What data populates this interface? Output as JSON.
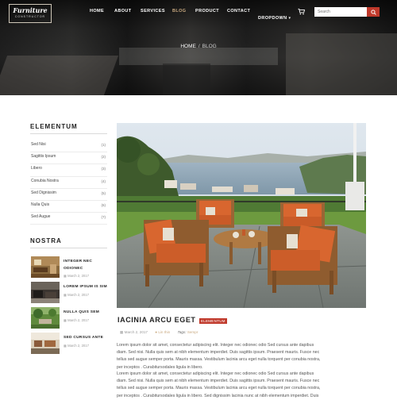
{
  "header": {
    "logo_title": "Furniture",
    "logo_subtitle": "CONSTRUCTOR",
    "nav": [
      {
        "label": "HOME",
        "active": false
      },
      {
        "label": "ABOUT",
        "active": false
      },
      {
        "label": "SERVICES",
        "active": false
      },
      {
        "label": "BLOG",
        "active": true
      },
      {
        "label": "PRODUCT",
        "active": false
      },
      {
        "label": "CONTACT",
        "active": false
      },
      {
        "label": "DROPDOWN",
        "active": false,
        "has_caret": true
      }
    ],
    "cart_icon": "cart-icon",
    "search_placeholder": "Search",
    "search_icon": "search-icon",
    "accent_color": "#c0392b"
  },
  "breadcrumb": {
    "home": "HOME",
    "separator": "/",
    "current": "BLOG"
  },
  "sidebar": {
    "categories_title": "ELEMENTUM",
    "categories": [
      {
        "label": "Sed Nisi",
        "count": "(1)"
      },
      {
        "label": "Sagittis Ipsum",
        "count": "(2)"
      },
      {
        "label": "Libero",
        "count": "(3)"
      },
      {
        "label": "Conubia Nostra",
        "count": "(4)"
      },
      {
        "label": "Sed Dignissim",
        "count": "(5)"
      },
      {
        "label": "Nulla Quis",
        "count": "(6)"
      },
      {
        "label": "Sed Augue",
        "count": "(7)"
      }
    ],
    "recent_title": "NOSTRA",
    "recent_posts": [
      {
        "title": "INTEGER NEC ODIONEC",
        "date": "March 2, 2017"
      },
      {
        "title": "LOREM IPSUM IS SIM",
        "date": "March 2, 2017"
      },
      {
        "title": "NULLA QUIS SEM",
        "date": "March 2, 2017"
      },
      {
        "title": "SED CURSUS ANTE",
        "date": "March 2, 2017"
      }
    ]
  },
  "post": {
    "title": "IACINIA ARCU EGET",
    "category_badge": "ELEMENTUM",
    "date": "March 2, 2017",
    "author": "Lin Ihin",
    "tags_label": "Tags:",
    "tags_value": "Sempr",
    "paragraphs": [
      [
        "Lorem ipsum dolor sit amet, consectetur adipiscing elit. Integer nec odionec odio Sed cursus ante dapibus",
        "diam. Sed nisi. Nulla quis sem at nibh elementum imperdiet. Duis sagittis ipsum. Praesent mauris. Fusce nec",
        "tellus sed augue semper porta. Mauris massa. Vestibulum lacinia arcu eget nulla torquent per conubia nostra,",
        "per inceptos . Curabitursodales ligula in libero."
      ],
      [
        "Lorem ipsum dolor sit amet, consectetur adipiscing elit. Integer nec odionec odio Sed cursus ante dapibus",
        "diam. Sed nisi. Nulla quis sem at nibh elementum imperdiet. Duis sagittis ipsum. Praesent mauris. Fusce nec",
        "tellus sed augue semper porta. Mauris massa. Vestibulum lacinia arcu eget nulla torquent per conubia nostra,",
        "per inceptos . Curabitursodales ligula in libero. Sed dignissim lacinia nunc at nibh elementum imperdiet. Duis"
      ]
    ]
  }
}
